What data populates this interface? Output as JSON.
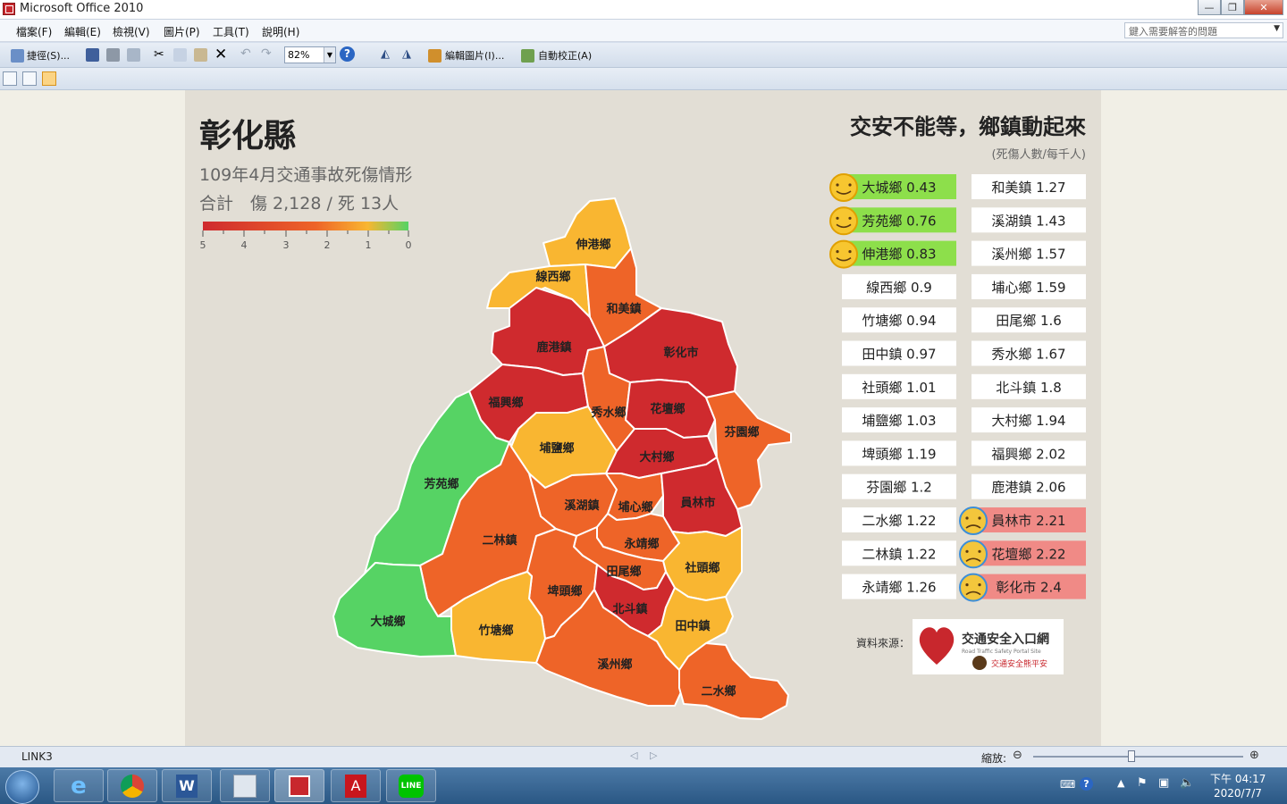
{
  "window": {
    "title": "Microsoft Office 2010"
  },
  "menu": [
    "檔案(F)",
    "編輯(E)",
    "檢視(V)",
    "圖片(P)",
    "工具(T)",
    "說明(H)"
  ],
  "help_box": {
    "placeholder": "鍵入需要解答的問題"
  },
  "toolbar": {
    "shortcut_label": "捷徑(S)...",
    "zoom": "82%",
    "edit_picture_label": "編輯圖片(I)...",
    "auto_correct_label": "自動校正(A)"
  },
  "slide": {
    "county": "彰化縣",
    "subtitle": "109年4月交通事故死傷情形",
    "totals": "合計　傷 2,128 / 死 13人",
    "legend_ticks": [
      "5",
      "4",
      "3",
      "2",
      "1",
      "0"
    ],
    "headline": "交安不能等，鄉鎮動起來",
    "unit_note": "(死傷人數/每千人)",
    "source_label": "資料來源：",
    "logo_title": "交通安全入口網",
    "logo_subtitle": "Road Traffic Safety Portal Site",
    "logo_tagline": "交通安全熊平安"
  },
  "colors": {
    "green": "#56d364",
    "yellow": "#f9b631",
    "orange": "#ee6428",
    "red": "#cf2a2e",
    "good_badge": "#8ddf4b",
    "bad_badge": "#f08a86"
  },
  "rank_left": [
    {
      "label": "大城鄉 0.43",
      "status": "good"
    },
    {
      "label": "芳苑鄉 0.76",
      "status": "good"
    },
    {
      "label": "伸港鄉 0.83",
      "status": "good"
    },
    {
      "label": "線西鄉 0.9",
      "status": "normal"
    },
    {
      "label": "竹塘鄉 0.94",
      "status": "normal"
    },
    {
      "label": "田中鎮 0.97",
      "status": "normal"
    },
    {
      "label": "社頭鄉 1.01",
      "status": "normal"
    },
    {
      "label": "埔鹽鄉 1.03",
      "status": "normal"
    },
    {
      "label": "埤頭鄉 1.19",
      "status": "normal"
    },
    {
      "label": "芬園鄉 1.2",
      "status": "normal"
    },
    {
      "label": "二水鄉 1.22",
      "status": "normal"
    },
    {
      "label": "二林鎮 1.22",
      "status": "normal"
    },
    {
      "label": "永靖鄉 1.26",
      "status": "normal"
    }
  ],
  "rank_right": [
    {
      "label": "和美鎮 1.27",
      "status": "normal"
    },
    {
      "label": "溪湖鎮 1.43",
      "status": "normal"
    },
    {
      "label": "溪州鄉 1.57",
      "status": "normal"
    },
    {
      "label": "埔心鄉 1.59",
      "status": "normal"
    },
    {
      "label": "田尾鄉 1.6",
      "status": "normal"
    },
    {
      "label": "秀水鄉 1.67",
      "status": "normal"
    },
    {
      "label": "北斗鎮 1.8",
      "status": "normal"
    },
    {
      "label": "大村鄉 1.94",
      "status": "normal"
    },
    {
      "label": "福興鄉 2.02",
      "status": "normal"
    },
    {
      "label": "鹿港鎮 2.06",
      "status": "normal"
    },
    {
      "label": "員林市 2.21",
      "status": "bad"
    },
    {
      "label": "花壇鄉 2.22",
      "status": "bad"
    },
    {
      "label": "彰化市 2.4",
      "status": "bad"
    }
  ],
  "map_regions": [
    {
      "name": "伸港鄉",
      "level": "yellow"
    },
    {
      "name": "線西鄉",
      "level": "yellow"
    },
    {
      "name": "和美鎮",
      "level": "orange"
    },
    {
      "name": "鹿港鎮",
      "level": "red"
    },
    {
      "name": "彰化市",
      "level": "red"
    },
    {
      "name": "福興鄉",
      "level": "red"
    },
    {
      "name": "秀水鄉",
      "level": "orange"
    },
    {
      "name": "花壇鄉",
      "level": "red"
    },
    {
      "name": "芬園鄉",
      "level": "orange"
    },
    {
      "name": "埔鹽鄉",
      "level": "yellow"
    },
    {
      "name": "大村鄉",
      "level": "red"
    },
    {
      "name": "芳苑鄉",
      "level": "green"
    },
    {
      "name": "溪湖鎮",
      "level": "orange"
    },
    {
      "name": "埔心鄉",
      "level": "orange"
    },
    {
      "name": "員林市",
      "level": "red"
    },
    {
      "name": "二林鎮",
      "level": "orange"
    },
    {
      "name": "永靖鄉",
      "level": "orange"
    },
    {
      "name": "社頭鄉",
      "level": "yellow"
    },
    {
      "name": "田尾鄉",
      "level": "orange"
    },
    {
      "name": "埤頭鄉",
      "level": "orange"
    },
    {
      "name": "北斗鎮",
      "level": "red"
    },
    {
      "name": "大城鄉",
      "level": "green"
    },
    {
      "name": "竹塘鄉",
      "level": "yellow"
    },
    {
      "name": "田中鎮",
      "level": "yellow"
    },
    {
      "name": "溪州鄉",
      "level": "orange"
    },
    {
      "name": "二水鄉",
      "level": "orange"
    }
  ],
  "status": {
    "left": "LINK3",
    "zoom_label": "縮放:",
    "zoom_level": 0.5
  },
  "taskbar": {
    "time": "下午 04:17",
    "date": "2020/7/7"
  }
}
